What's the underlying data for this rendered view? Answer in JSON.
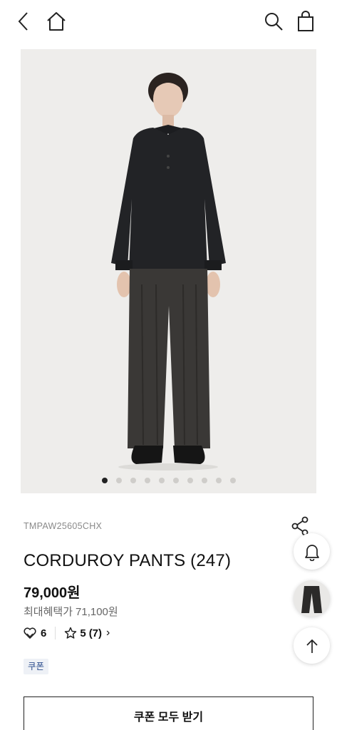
{
  "product": {
    "code": "TMPAW25605CHX",
    "name": "CORDUROY PANTS (247)",
    "price": "79,000원",
    "max_benefit_label": "최대혜택가",
    "max_benefit_price": "71,100원",
    "likes": "6",
    "rating": "5",
    "review_count": "(7)",
    "rating_chevron": "›",
    "coupon_badge": "쿠폰"
  },
  "gallery": {
    "total_images": 10,
    "current_index": 1
  },
  "actions": {
    "coupon_button": "쿠폰 모두 받기"
  },
  "icons": {
    "back": "back-chevron-icon",
    "home": "home-icon",
    "search": "search-icon",
    "cart": "shopping-bag-icon",
    "share": "share-icon",
    "bell": "bell-icon",
    "scroll_top": "arrow-up-icon"
  }
}
